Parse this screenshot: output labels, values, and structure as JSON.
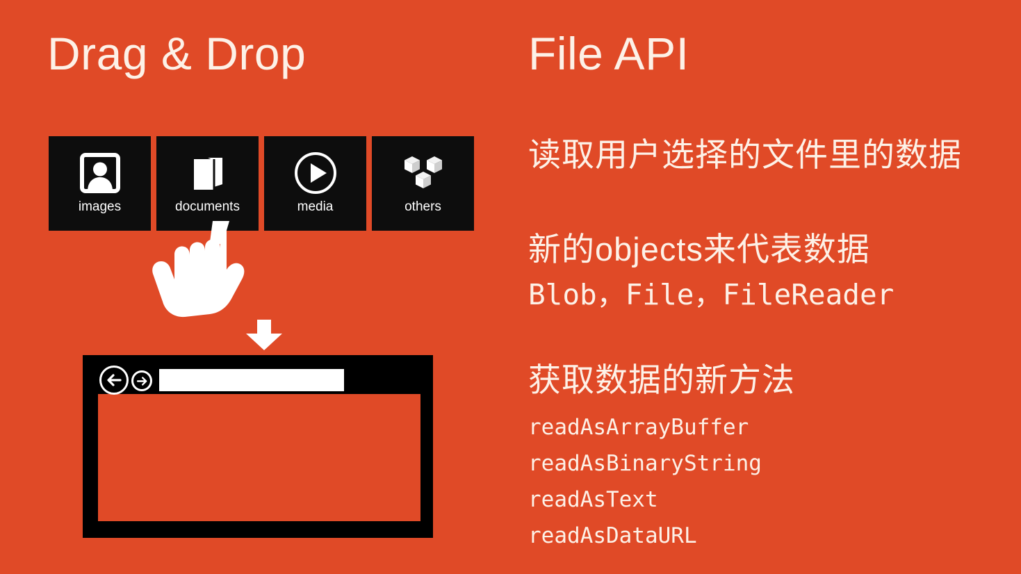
{
  "slide": {
    "background_color": "#e04a27",
    "text_color": "#fdf1e7",
    "tile_background_color": "#0d0d0d"
  },
  "left_column": {
    "title": "Drag & Drop",
    "tiles": [
      {
        "label": "images",
        "icon": "portrait-photo-icon"
      },
      {
        "label": "documents",
        "icon": "folder-icon"
      },
      {
        "label": "media",
        "icon": "play-circle-icon"
      },
      {
        "label": "others",
        "icon": "cubes-icon"
      }
    ],
    "cursor": "pointing-hand-cursor",
    "drop_arrow": "down-arrow-icon",
    "browser": {
      "back_button": "back-arrow-icon",
      "forward_button": "forward-arrow-icon",
      "address_bar_value": "",
      "address_bar_placeholder": ""
    }
  },
  "right_column": {
    "title": "File API",
    "sections": [
      {
        "heading": "读取用户选择的文件里的数据",
        "items": []
      },
      {
        "heading": "新的objects来代表数据",
        "code_line": "Blob，File，FileReader",
        "items": []
      },
      {
        "heading": "获取数据的新方法",
        "items": [
          "readAsArrayBuffer",
          "readAsBinaryString",
          "readAsText",
          "readAsDataURL"
        ]
      }
    ]
  }
}
